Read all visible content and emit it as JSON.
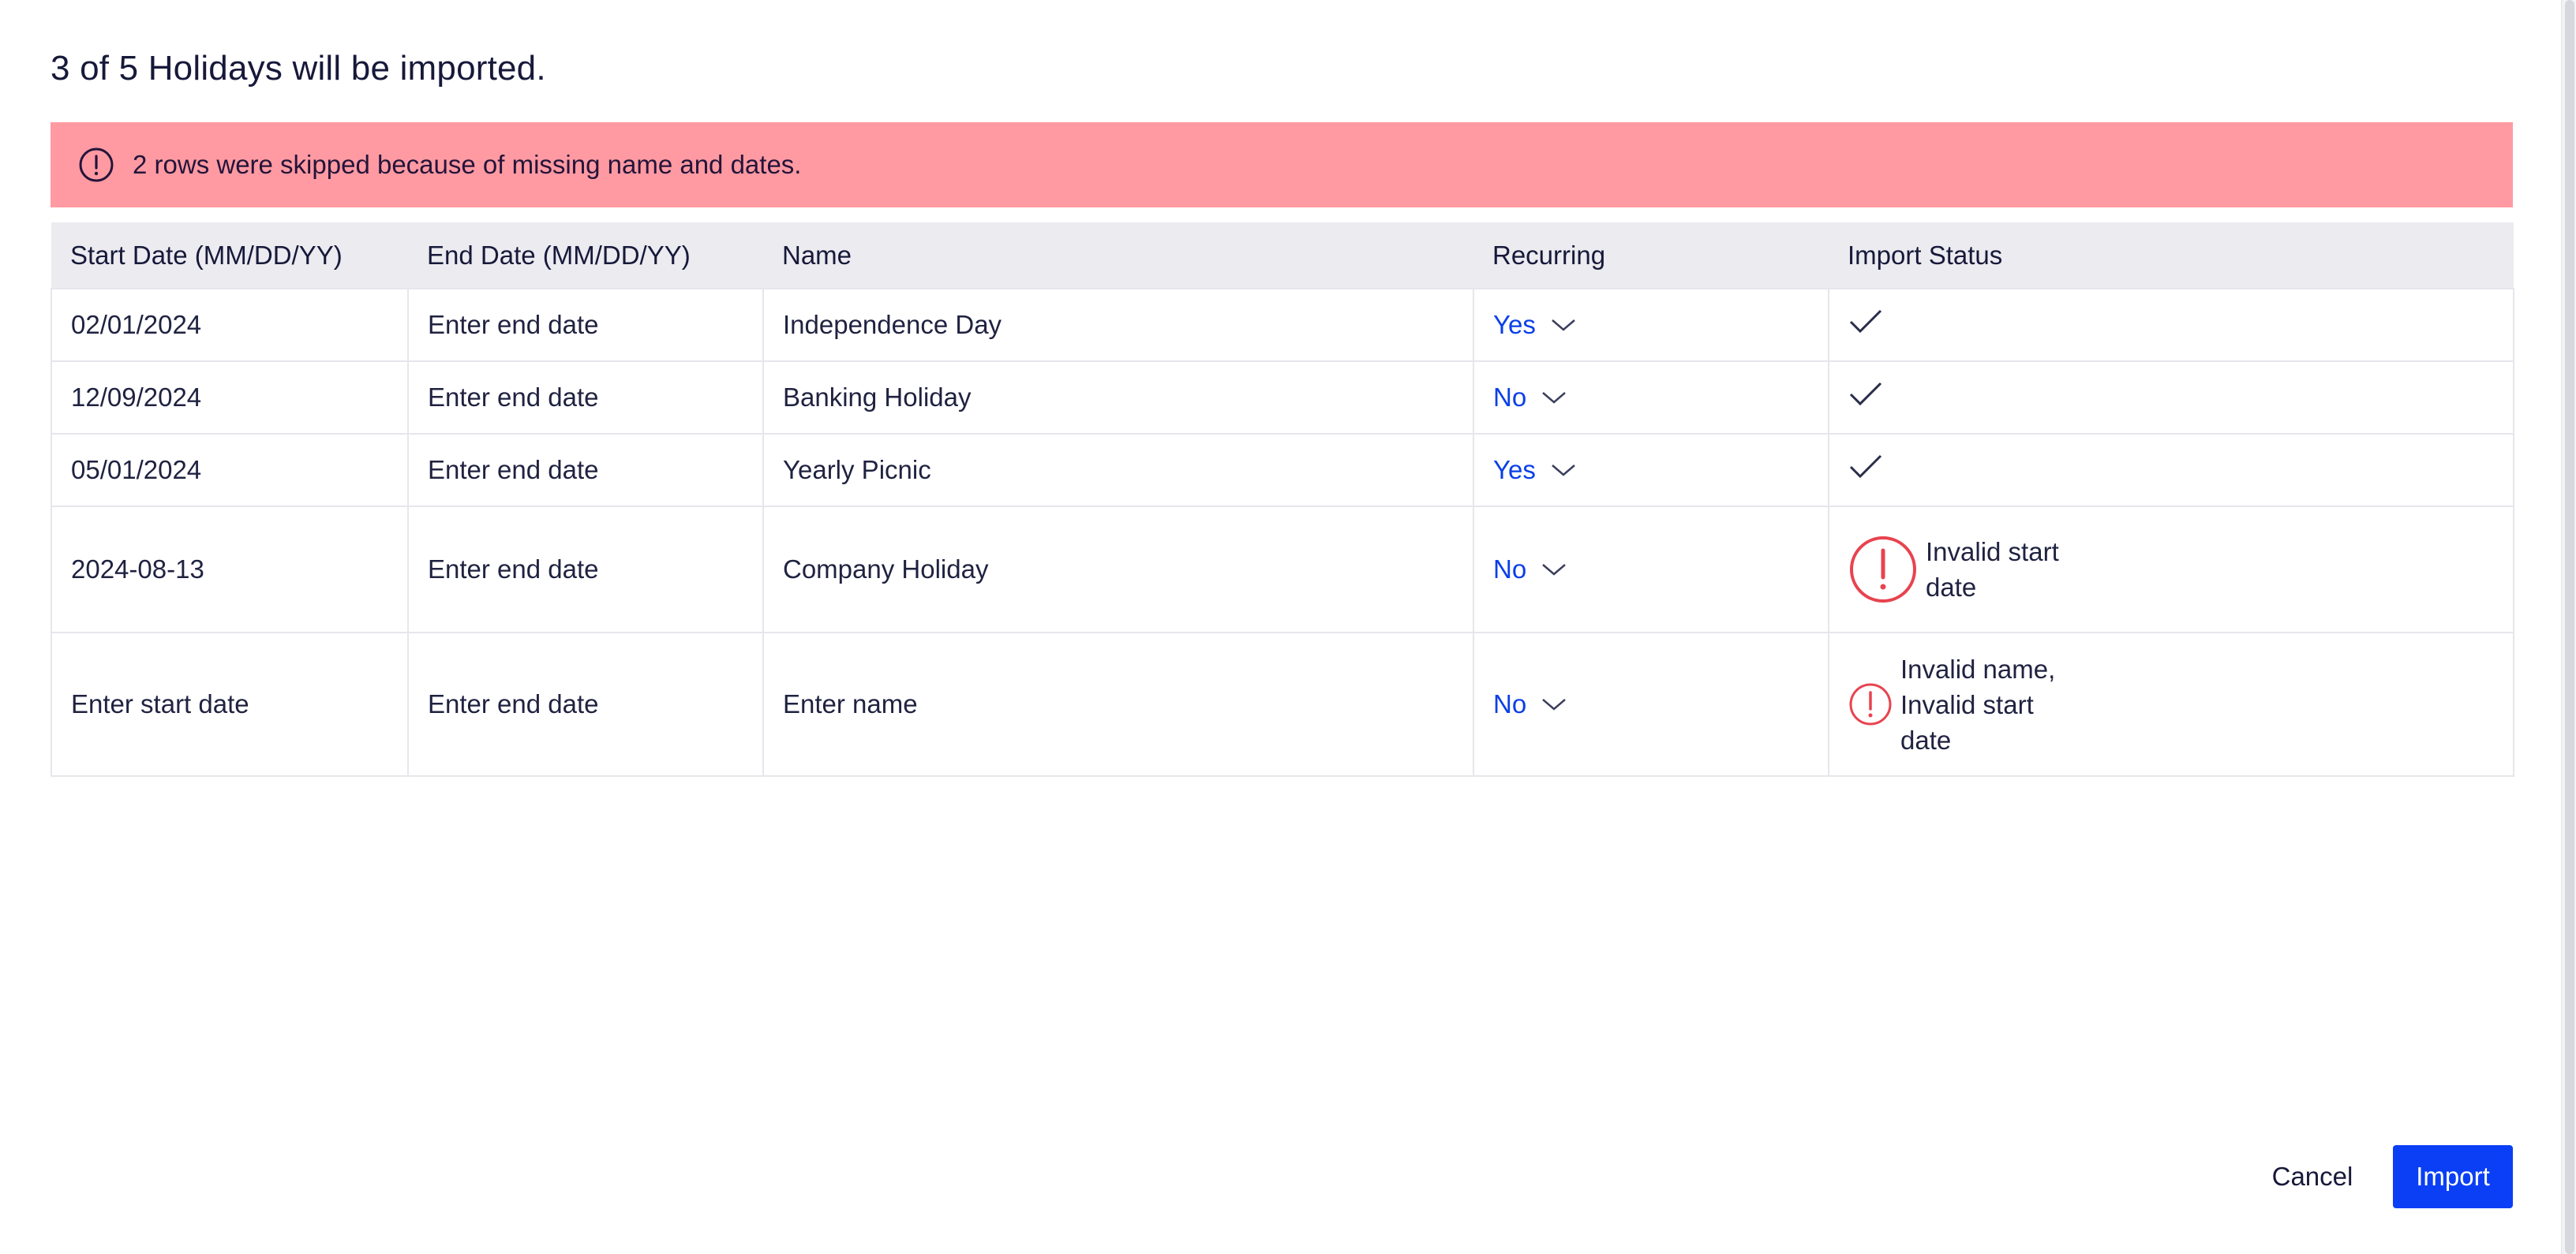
{
  "dialog": {
    "title": "3 of 5 Holidays will be imported."
  },
  "alert": {
    "icon": "alert-circle-icon",
    "message": "2 rows were skipped because of missing name and dates.",
    "color": "#ff9aa2"
  },
  "table": {
    "headers": {
      "start": "Start Date (MM/DD/YY)",
      "end": "End Date (MM/DD/YY)",
      "name": "Name",
      "recurring": "Recurring",
      "status": "Import Status"
    },
    "rows": [
      {
        "start": "02/01/2024",
        "end_placeholder": "Enter end date",
        "name": "Independence Day",
        "recurring": "Yes",
        "status": "success"
      },
      {
        "start": "12/09/2024",
        "end_placeholder": "Enter end date",
        "name": "Banking Holiday",
        "recurring": "No",
        "status": "success"
      },
      {
        "start": "05/01/2024",
        "end_placeholder": "Enter end date",
        "name": "Yearly Picnic",
        "recurring": "Yes",
        "status": "success"
      },
      {
        "start": "2024-08-13",
        "end_placeholder": "Enter end date",
        "name": "Company Holiday",
        "recurring": "No",
        "status": "error",
        "status_line1": "Invalid start",
        "status_line2": "date"
      },
      {
        "start_placeholder": "Enter start date",
        "end_placeholder": "Enter end date",
        "name_placeholder": "Enter name",
        "recurring": "No",
        "status": "error",
        "status_line1": "Invalid name,",
        "status_line2": "Invalid start",
        "status_line3": "date"
      }
    ]
  },
  "footer": {
    "cancel_label": "Cancel",
    "import_label": "Import"
  },
  "colors": {
    "accent": "#0a3ff5",
    "error": "#e8434f",
    "header_bg": "#ebebf0"
  }
}
